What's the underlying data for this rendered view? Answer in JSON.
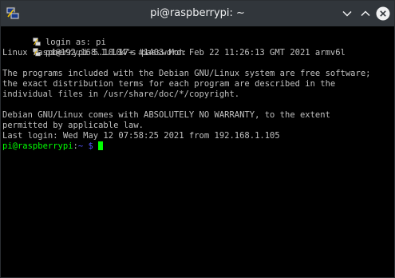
{
  "window": {
    "title": "pi@raspberrypi: ~"
  },
  "terminal": {
    "lines": [
      "login as: pi",
      "pi@192.168.1.104's password:",
      "Linux raspberrypi 5.10.17+ #1403 Mon Feb 22 11:26:13 GMT 2021 armv6l",
      "",
      "The programs included with the Debian GNU/Linux system are free software;",
      "the exact distribution terms for each program are described in the",
      "individual files in /usr/share/doc/*/copyright.",
      "",
      "Debian GNU/Linux comes with ABSOLUTELY NO WARRANTY, to the extent",
      "permitted by applicable law.",
      "Last login: Wed May 12 07:58:25 2021 from 192.168.1.105"
    ],
    "prompt": {
      "user_host": "pi@raspberrypi",
      "colon": ":",
      "path": "~",
      "symbol": "$"
    }
  },
  "colors": {
    "titlebar": "#31363b",
    "terminal_bg": "#000000",
    "terminal_fg": "#c0c0c0",
    "prompt_green": "#00ff00",
    "prompt_blue": "#5555ff"
  },
  "icons": {
    "window": "putty-terminal-icon",
    "minimize": "chevron-down-icon",
    "maximize": "chevron-up-icon",
    "close": "close-icon",
    "line_marker": "putty-icon"
  }
}
